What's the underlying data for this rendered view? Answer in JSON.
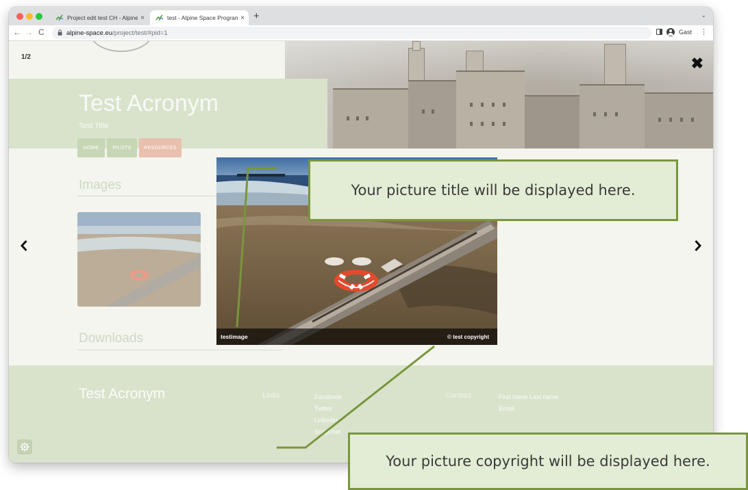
{
  "browser": {
    "tabs": [
      {
        "title": "Project edit test CH - Alpine Sp",
        "active": false
      },
      {
        "title": "test - Alpine Space Programme",
        "active": true
      }
    ],
    "new_tab_glyph": "+",
    "tab_close_glyph": "×",
    "tab_menu_glyph": "⌄",
    "url_host": "alpine-space.eu",
    "url_path": "/project/test/#pid=1",
    "profile_label": "Gast",
    "back_glyph": "←",
    "forward_glyph": "→",
    "reload_glyph": "C",
    "menu_glyph": "⋮",
    "lock_glyph": "🔒"
  },
  "page": {
    "counter": "1/2",
    "hero": {
      "acronym": "Test Acronym",
      "title": "Test Title"
    },
    "nav": {
      "home": "HOME",
      "pilots": "PILOTS",
      "resources": "RESOURCES"
    },
    "sections": {
      "images": "Images",
      "downloads": "Downloads"
    },
    "footer": {
      "acronym": "Test Acronym",
      "links_heading": "Links",
      "links": [
        "Facebook",
        "Twitter",
        "Linkedin",
        "Snapchat"
      ],
      "contact_heading": "Contact",
      "contact": [
        "First name Last name",
        "Email"
      ]
    }
  },
  "lightbox": {
    "caption": "testimage",
    "copyright": "© test copyright",
    "close_glyph": "✖",
    "prev_glyph": "‹",
    "next_glyph": "›"
  },
  "annotations": {
    "title_note": "Your picture title will be displayed here.",
    "copyright_note": "Your picture copyright will be displayed here."
  },
  "colors": {
    "accent_green": "#79963d",
    "callout_fill": "#e3ecd4",
    "brand_pale_green": "#d9e3cc",
    "resources_pill": "#e9bfae"
  },
  "icons": {
    "cookie": "gear-icon",
    "close": "close-icon",
    "prev": "chevron-left-icon",
    "next": "chevron-right-icon"
  }
}
